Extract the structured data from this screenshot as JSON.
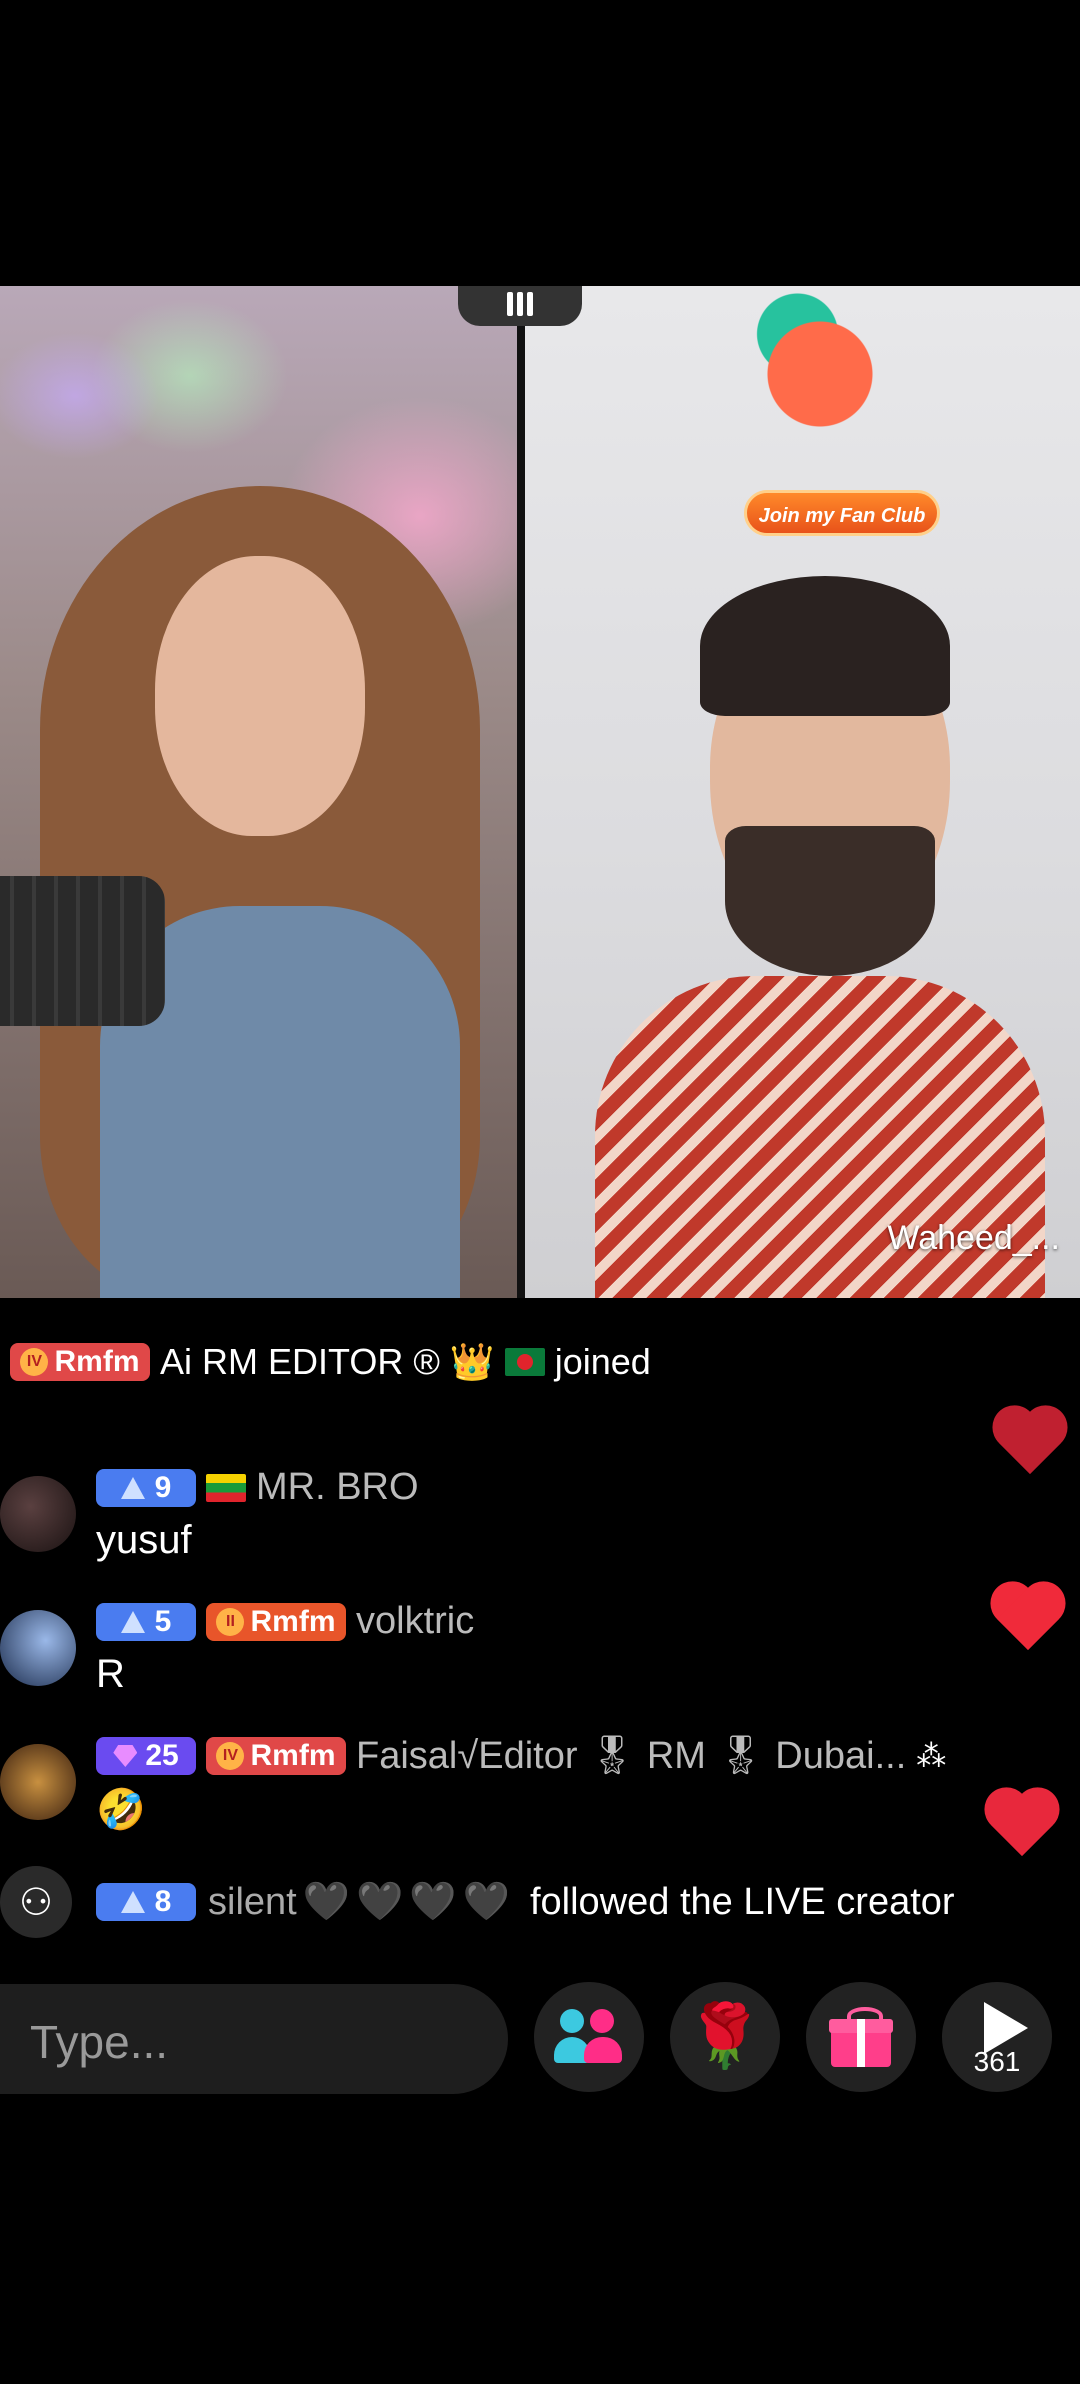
{
  "live_battle": {
    "fan_club_button": "Join my Fan Club",
    "right_host_name": "Waheed_..."
  },
  "join_notice": {
    "fan_badge": "Rmfm",
    "user": "Ai RM EDITOR ®",
    "action": "joined"
  },
  "comments": [
    {
      "level": "9",
      "fan_badge": "",
      "flag": "myanmar",
      "user": "MR. BRO",
      "message": "yusuf"
    },
    {
      "level": "5",
      "fan_badge": "Rmfm",
      "flag": "",
      "user": "volktric",
      "message": "R"
    },
    {
      "level": "25",
      "fan_badge": "Rmfm",
      "flag": "",
      "user": "Faisal√Editor 🎖 RM 🎖 Dubai...",
      "message": "🤣"
    }
  ],
  "follow_notice": {
    "level": "8",
    "user": "silent",
    "hearts": "🖤🖤🖤🖤",
    "action": "followed the LIVE creator"
  },
  "bottom_bar": {
    "input_placeholder": "Type...",
    "share_count": "361"
  }
}
